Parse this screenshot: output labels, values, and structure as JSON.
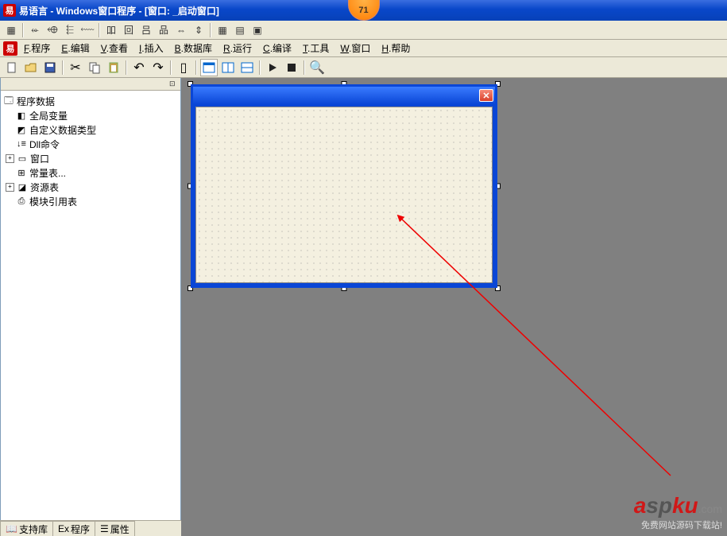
{
  "title": "易语言 - Windows窗口程序 - [窗口: _启动窗口]",
  "badge": "71",
  "menu": {
    "file": {
      "hot": "F",
      "label": ".程序"
    },
    "edit": {
      "hot": "E",
      "label": ".编辑"
    },
    "view": {
      "hot": "V",
      "label": ".查看"
    },
    "insert": {
      "hot": "I",
      "label": ".插入"
    },
    "db": {
      "hot": "B",
      "label": ".数据库"
    },
    "run": {
      "hot": "R",
      "label": ".运行"
    },
    "compile": {
      "hot": "C",
      "label": ".编译"
    },
    "tools": {
      "hot": "T",
      "label": ".工具"
    },
    "window": {
      "hot": "W",
      "label": ".窗口"
    },
    "help": {
      "hot": "H",
      "label": ".帮助"
    }
  },
  "tree": {
    "root": "程序数据",
    "n1": "全局变量",
    "n2": "自定义数据类型",
    "n3": "Dll命令",
    "n4": "窗口",
    "n5": "常量表...",
    "n6": "资源表",
    "n7": "模块引用表"
  },
  "bottom_tabs": {
    "t1": "支持库",
    "t2": "程序",
    "t3": "属性"
  },
  "watermark": {
    "brand_a": "a",
    "brand_sp": "sp",
    "brand_k": "k",
    "brand_u": "u",
    "brand_com": ".com",
    "sub": "免费网站源码下载站!"
  }
}
